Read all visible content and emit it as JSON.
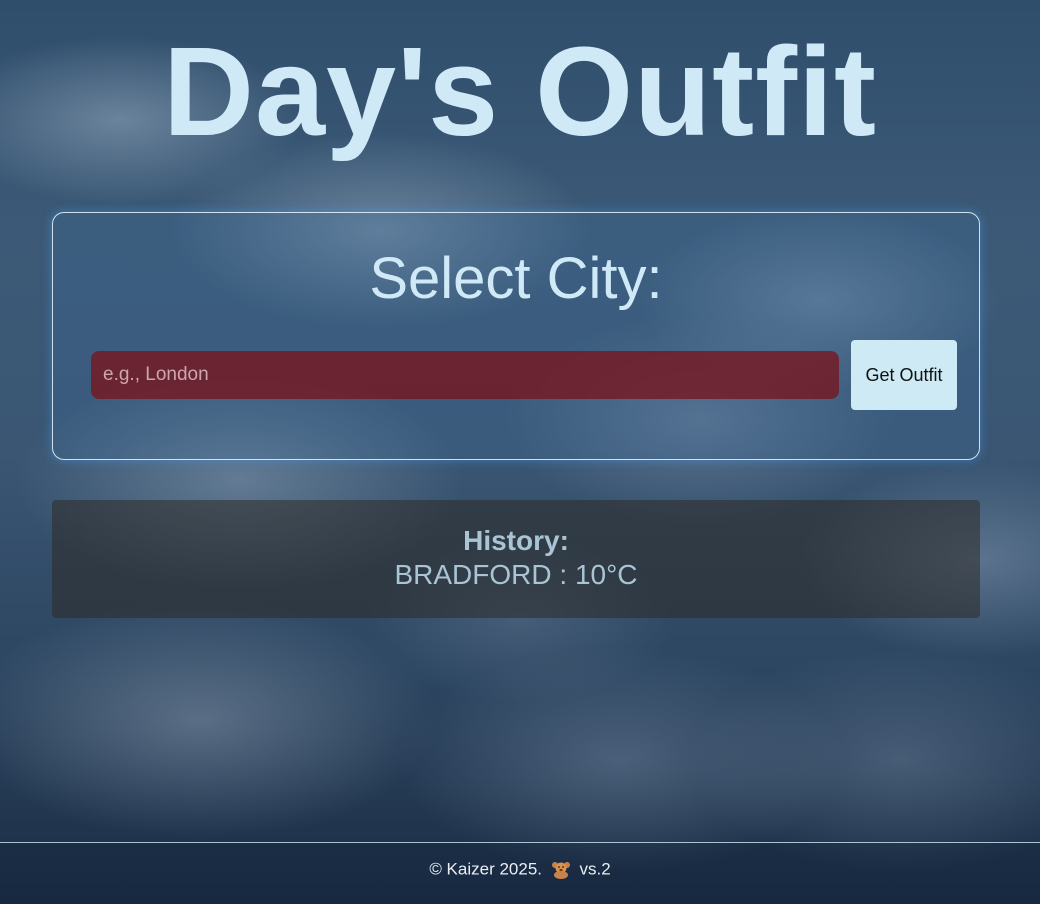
{
  "header": {
    "title": "Day's Outfit"
  },
  "search_card": {
    "heading": "Select City:",
    "input_value": "",
    "input_placeholder": "e.g., London",
    "button_label": "Get Outfit"
  },
  "history": {
    "heading": "History:",
    "entries": [
      "BRADFORD : 10°C"
    ]
  },
  "footer": {
    "copyright": "© Kaizer 2025.",
    "icon": "teddy-bear-icon",
    "version": "vs.2"
  },
  "colors": {
    "title": "#cfeaf6",
    "input_background": "#7a141c",
    "button_background": "#cdeaf5",
    "card_glow": "#46a0e6"
  }
}
